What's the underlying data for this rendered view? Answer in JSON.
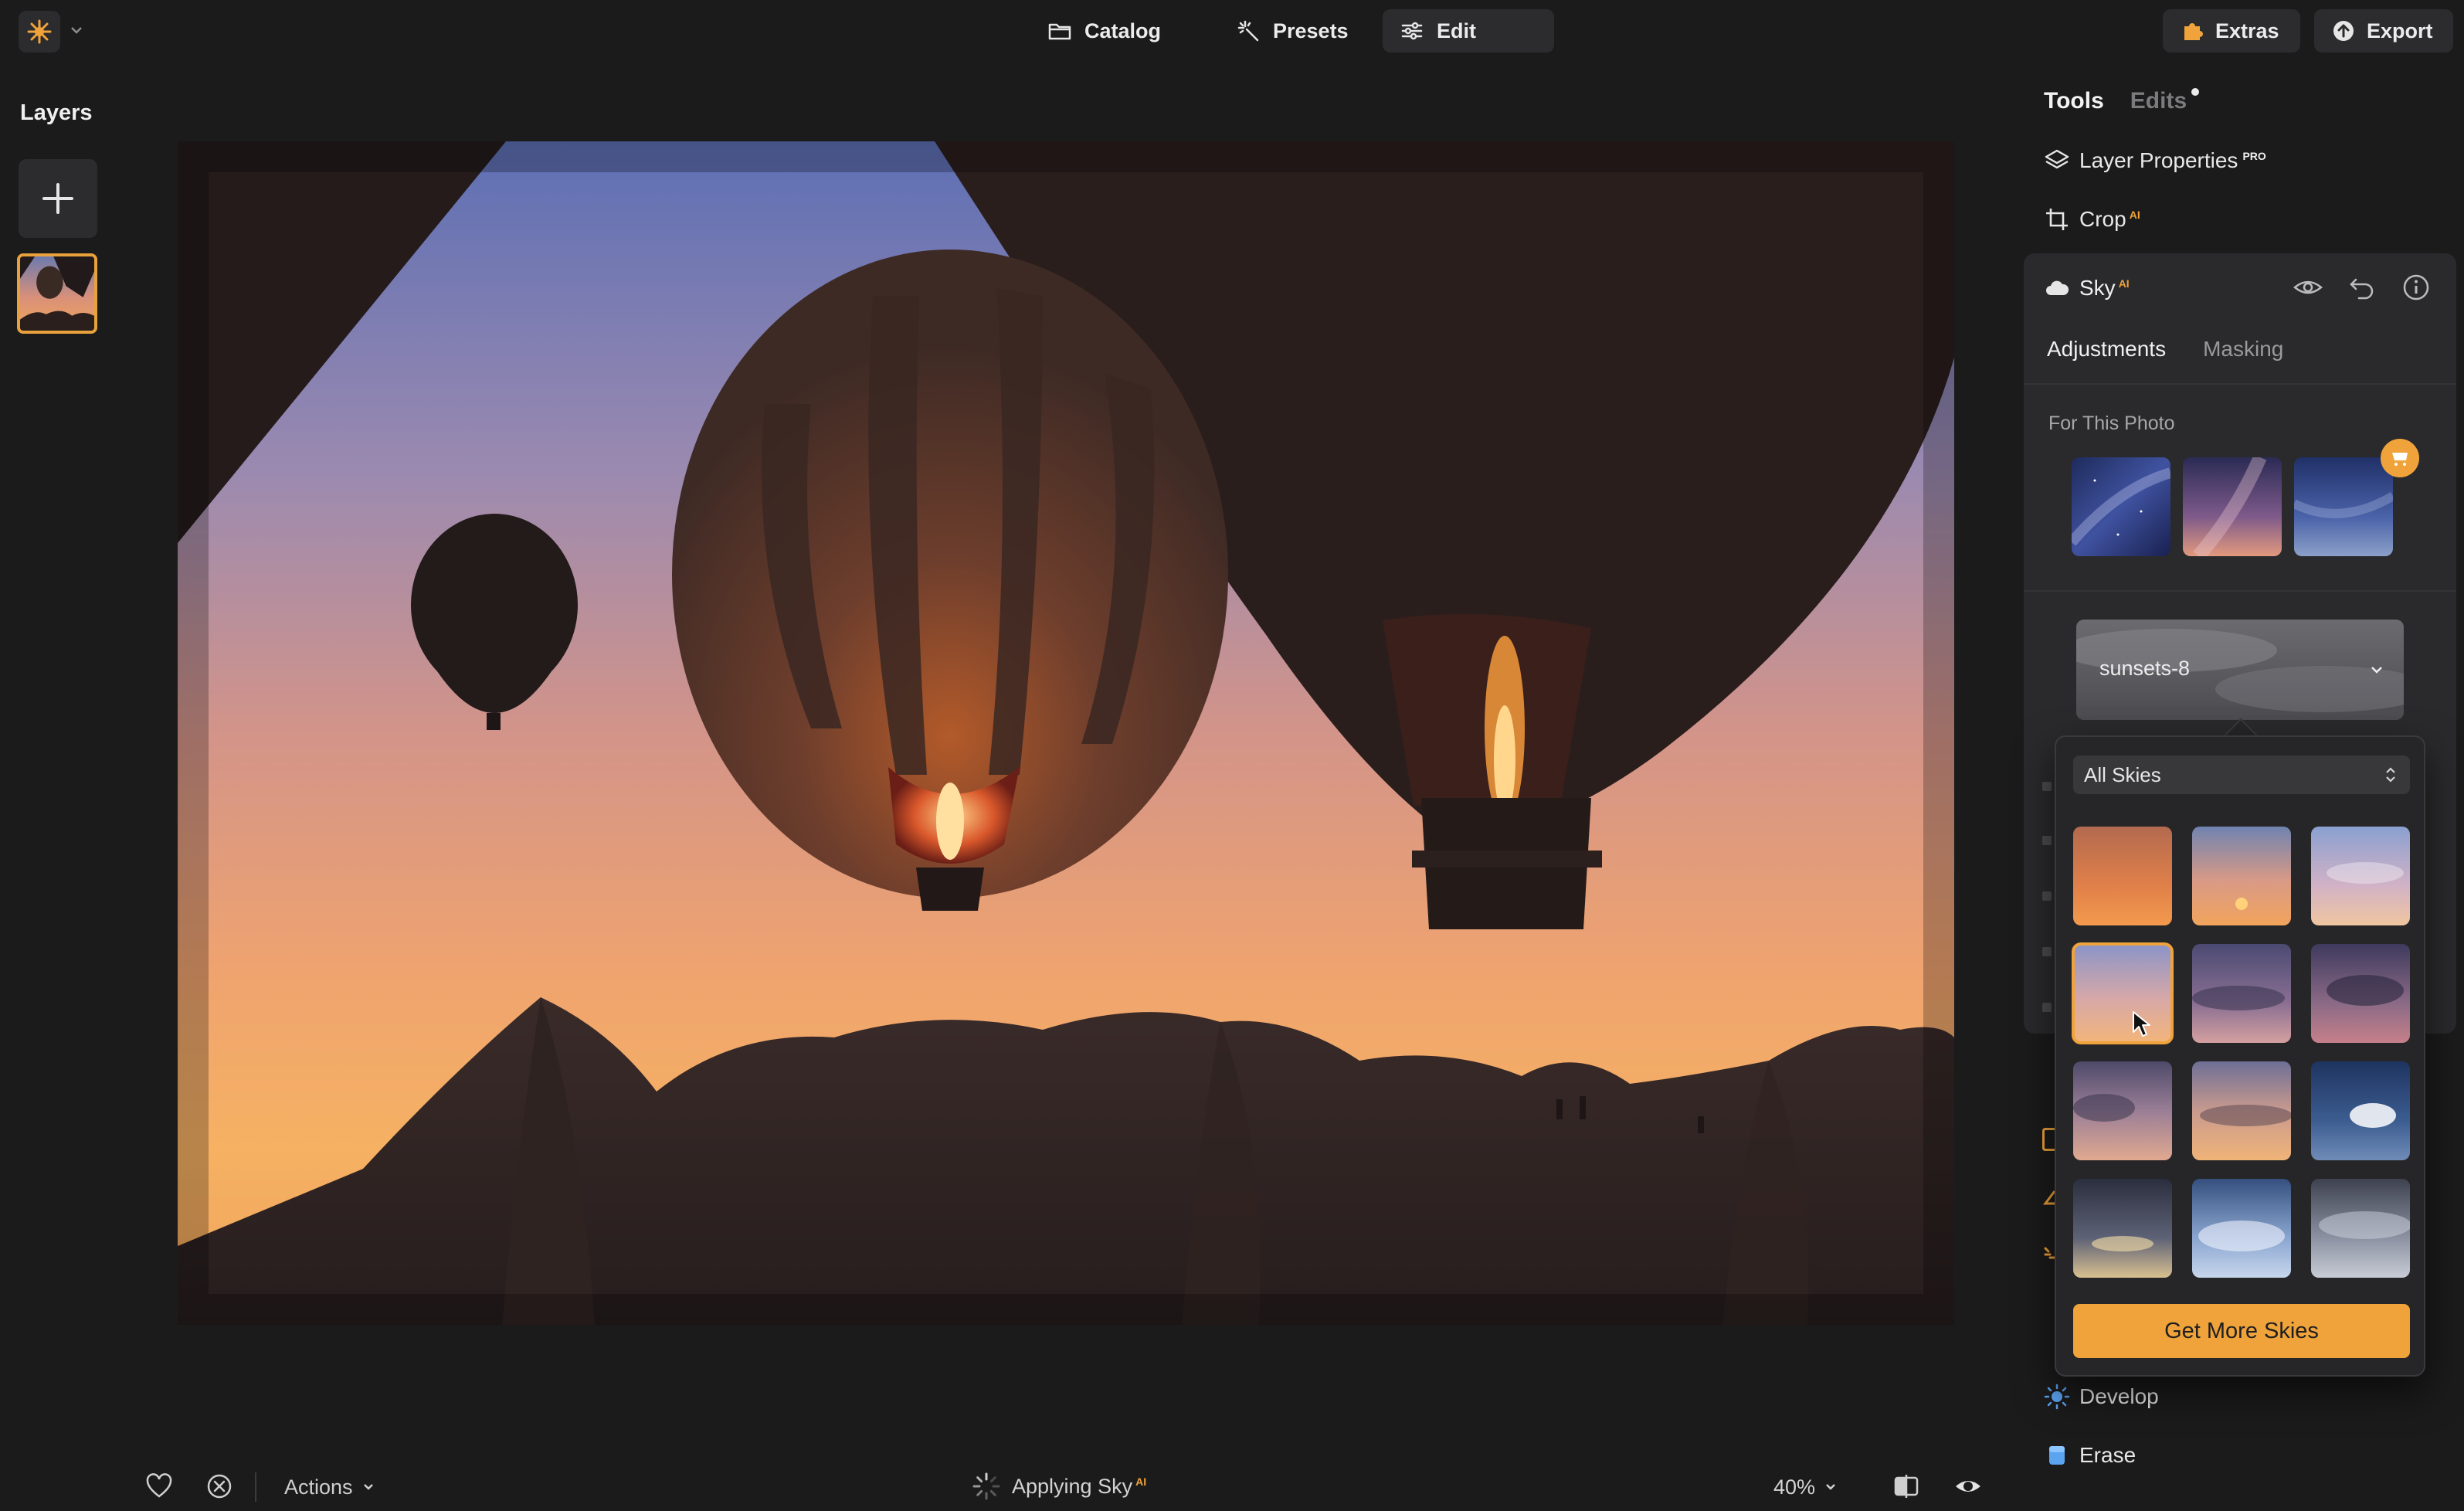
{
  "topbar": {
    "nav": [
      {
        "label": "Catalog",
        "icon": "folder-icon"
      },
      {
        "label": "Presets",
        "icon": "sparkle-icon"
      },
      {
        "label": "Edit",
        "icon": "sliders-icon",
        "active": true
      }
    ],
    "extras_label": "Extras",
    "export_label": "Export"
  },
  "layers": {
    "title": "Layers"
  },
  "bottombar": {
    "actions_label": "Actions",
    "status_label": "Applying Sky",
    "status_badge": "AI",
    "zoom": "40%"
  },
  "panel": {
    "tabs": [
      {
        "label": "Tools",
        "active": true
      },
      {
        "label": "Edits",
        "active": false,
        "has_changes_dot": true
      }
    ],
    "layer_properties": {
      "label": "Layer Properties",
      "badge": "PRO"
    },
    "crop": {
      "label": "Crop",
      "badge": "AI"
    },
    "sky": {
      "label": "Sky",
      "badge": "AI",
      "subtabs": [
        "Adjustments",
        "Masking"
      ],
      "active_subtab": "Adjustments",
      "for_this_photo_label": "For This Photo",
      "selected_sky": "sunsets-8"
    },
    "develop_label": "Develop",
    "erase_label": "Erase"
  },
  "sky_popover": {
    "filter_value": "All Skies",
    "get_more_label": "Get More Skies",
    "tile_count": 12,
    "selected_index": 3
  },
  "colors": {
    "accent": "#f0a33a",
    "background": "#1b1b1c",
    "panel": "#2a2a2c"
  }
}
